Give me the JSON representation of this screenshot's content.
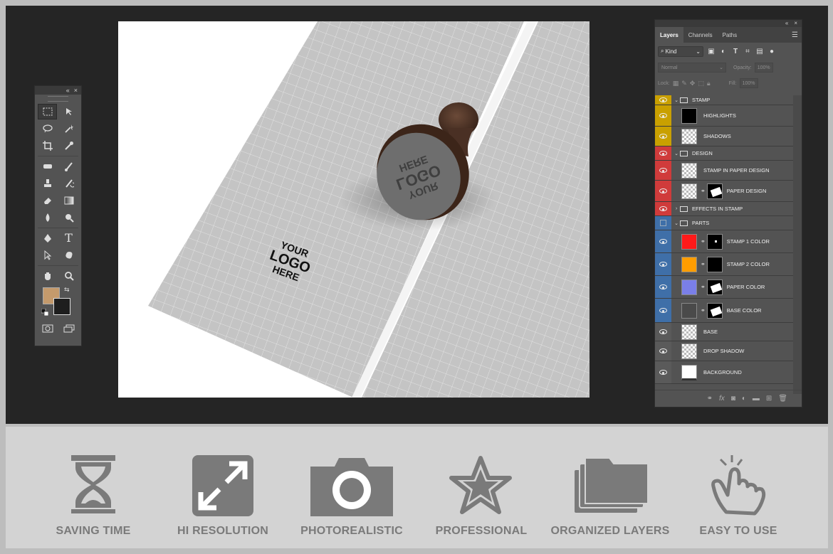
{
  "tools_panel": {
    "collapse_glyph": "«",
    "close_glyph": "×",
    "type_tool_glyph": "T",
    "foreground_color": "#c49a6c",
    "background_color": "#1e1e1e"
  },
  "canvas": {
    "paper_logo": [
      "YOUR",
      "LOGO",
      "HERE"
    ],
    "stamp_logo": [
      "YOUR",
      "LOGO",
      "HERE"
    ]
  },
  "layers_panel": {
    "collapse_glyph": "«",
    "close_glyph": "×",
    "tabs": [
      "Layers",
      "Channels",
      "Paths"
    ],
    "filter_kind": "Kind",
    "blend_mode": "Normal",
    "opacity_label": "Opacity:",
    "opacity_value": "100%",
    "lock_label": "Lock:",
    "fill_label": "Fill:",
    "fill_value": "100%",
    "layers": [
      {
        "name": "STAMP",
        "kind": "group",
        "color": "#c9a000"
      },
      {
        "name": "HIGHLIGHTS",
        "kind": "layer",
        "color": "#c9a000"
      },
      {
        "name": "SHADOWS",
        "kind": "layer",
        "color": "#c9a000"
      },
      {
        "name": "DESIGN",
        "kind": "group",
        "color": "#d03b3b"
      },
      {
        "name": "STAMP IN PAPER DESIGN",
        "kind": "smart",
        "color": "#d03b3b"
      },
      {
        "name": "PAPER DESIGN",
        "kind": "smart-mask",
        "color": "#d03b3b"
      },
      {
        "name": "EFFECTS IN STAMP",
        "kind": "group",
        "color": "#d03b3b"
      },
      {
        "name": "PARTS",
        "kind": "group",
        "color": "#3f6fa8"
      },
      {
        "name": "STAMP 1 COLOR",
        "kind": "fill-mask",
        "color": "#3f6fa8",
        "fill": "#ff1a1a"
      },
      {
        "name": "STAMP 2 COLOR",
        "kind": "fill-mask",
        "color": "#3f6fa8",
        "fill": "#ff9d00"
      },
      {
        "name": "PAPER COLOR",
        "kind": "fill-mask",
        "color": "#3f6fa8",
        "fill": "#7a7fe8"
      },
      {
        "name": "BASE COLOR",
        "kind": "fill-mask",
        "color": "#3f6fa8",
        "fill": "#4a4a4a"
      },
      {
        "name": "BASE",
        "kind": "layer",
        "color": "#5a5a5a"
      },
      {
        "name": "DROP SHADOW",
        "kind": "layer",
        "color": "#5a5a5a"
      },
      {
        "name": "BACKGROUND",
        "kind": "layer",
        "color": "#5a5a5a"
      }
    ]
  },
  "features": [
    {
      "label": "SAVING TIME",
      "icon": "hourglass-icon"
    },
    {
      "label": "HI RESOLUTION",
      "icon": "expand-icon"
    },
    {
      "label": "PHOTOREALISTIC",
      "icon": "camera-icon"
    },
    {
      "label": "PROFESSIONAL",
      "icon": "star-icon"
    },
    {
      "label": "ORGANIZED LAYERS",
      "icon": "folders-icon"
    },
    {
      "label": "EASY TO USE",
      "icon": "tap-hand-icon"
    }
  ]
}
